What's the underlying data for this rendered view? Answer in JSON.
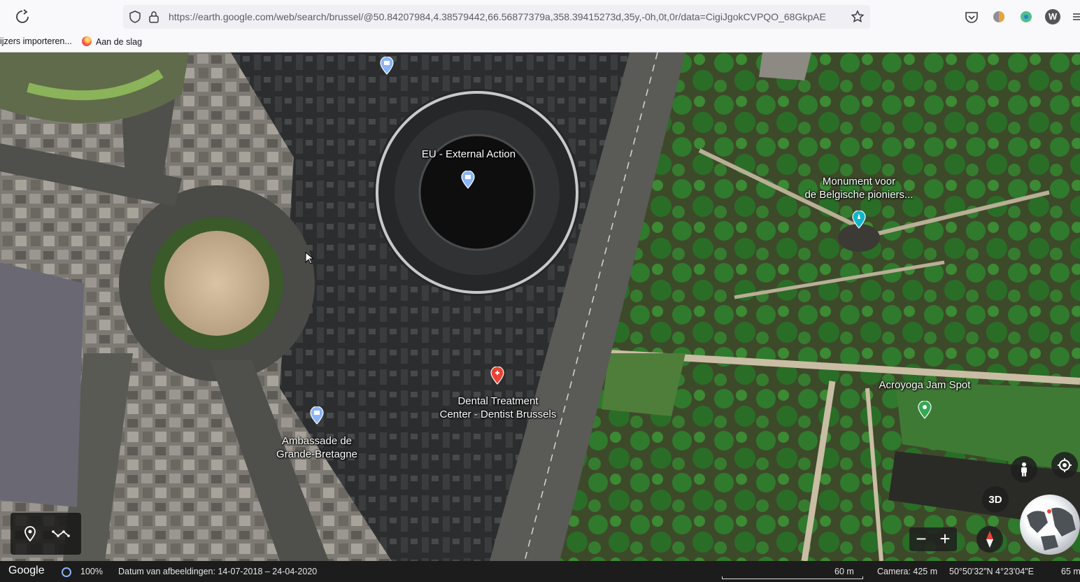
{
  "browser": {
    "url": "https://earth.google.com/web/search/brussel/@50.84207984,4.38579442,66.56877379a,358.39415273d,35y,-0h,0t,0r/data=CigiJgokCVPQO_68GkpAE",
    "profile_initial": "W",
    "bookmarks": [
      {
        "label": "ijzers importeren..."
      },
      {
        "label": "Aan de slag"
      }
    ]
  },
  "map": {
    "labels": [
      {
        "text": "EU - External Action"
      },
      {
        "text": "Monument voor"
      },
      {
        "text": "de Belgische pioniers..."
      },
      {
        "text": "Acroyoga Jam Spot"
      },
      {
        "text": "Dental Treatment"
      },
      {
        "text": "Center - Dentist Brussels"
      },
      {
        "text": "Ambassade de"
      },
      {
        "text": "Grande-Bretagne"
      }
    ],
    "controls": {
      "mode_3d": "3D",
      "zoom_out": "−",
      "zoom_in": "+"
    }
  },
  "status": {
    "logo": "Google",
    "progress": "100%",
    "imagery_date": "Datum van afbeeldingen: 14-07-2018 – 24-04-2020",
    "scale": "60 m",
    "camera": "Camera: 425 m",
    "coords": "50°50'32\"N 4°23'04\"E",
    "elevation": "65 m"
  },
  "colors": {
    "pin_blue": "#8ab4f8",
    "pin_red": "#ea4335",
    "pin_green": "#34a853",
    "pin_teal": "#12b5cb"
  }
}
